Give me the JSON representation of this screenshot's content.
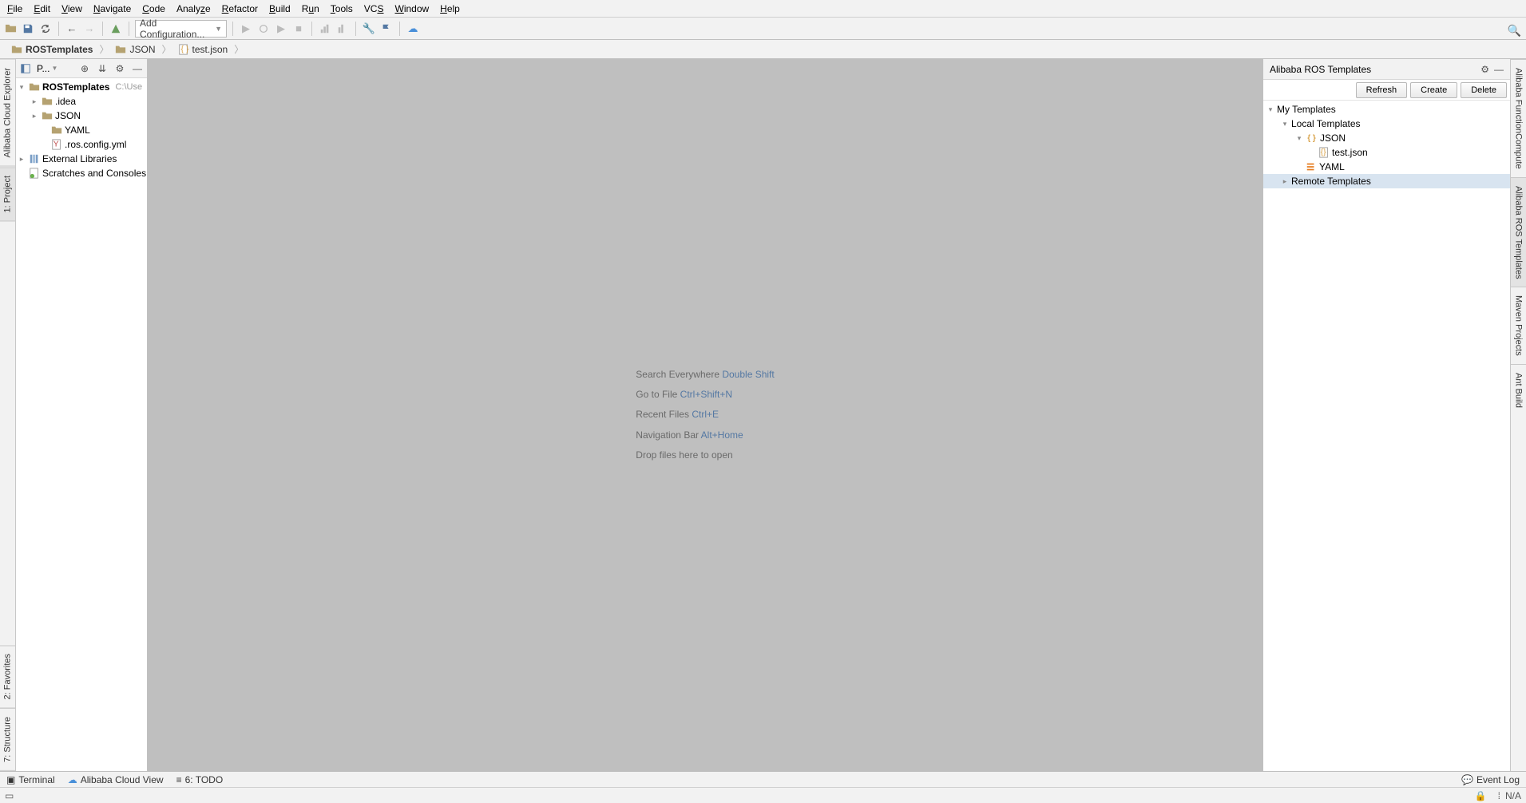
{
  "menu": {
    "items": [
      "File",
      "Edit",
      "View",
      "Navigate",
      "Code",
      "Analyze",
      "Refactor",
      "Build",
      "Run",
      "Tools",
      "VCS",
      "Window",
      "Help"
    ]
  },
  "toolbar": {
    "config": "Add Configuration..."
  },
  "breadcrumb": [
    {
      "icon": "folder",
      "text": "ROSTemplates",
      "bold": true
    },
    {
      "icon": "folder",
      "text": "JSON",
      "bold": false
    },
    {
      "icon": "json",
      "text": "test.json",
      "bold": false
    }
  ],
  "left_tabs": {
    "project": "1: Project",
    "explorer": "Alibaba Cloud Explorer",
    "structure": "7: Structure",
    "favorites": "2: Favorites"
  },
  "right_tabs": {
    "func": "Alibaba FunctionCompute",
    "ros": "Alibaba ROS Templates",
    "maven": "Maven Projects",
    "ant": "Ant Build"
  },
  "project": {
    "header_view": "P...",
    "root": {
      "name": "ROSTemplates",
      "path": "C:\\Use"
    },
    "children": [
      {
        "name": ".idea",
        "kind": "folder",
        "expand": true
      },
      {
        "name": "JSON",
        "kind": "folder",
        "expand": true
      },
      {
        "name": "YAML",
        "kind": "folder",
        "expand": false
      },
      {
        "name": ".ros.config.yml",
        "kind": "yamlfile",
        "expand": false
      }
    ],
    "external": "External Libraries",
    "scratches": "Scratches and Consoles"
  },
  "editor_hints": [
    {
      "label": "Search Everywhere",
      "shortcut": "Double Shift"
    },
    {
      "label": "Go to File",
      "shortcut": "Ctrl+Shift+N"
    },
    {
      "label": "Recent Files",
      "shortcut": "Ctrl+E"
    },
    {
      "label": "Navigation Bar",
      "shortcut": "Alt+Home"
    },
    {
      "label": "Drop files here to open",
      "shortcut": ""
    }
  ],
  "ros": {
    "title": "Alibaba ROS Templates",
    "buttons": {
      "refresh": "Refresh",
      "create": "Create",
      "delete": "Delete"
    },
    "tree": {
      "root": "My Templates",
      "local": "Local Templates",
      "json": "JSON",
      "testjson": "test.json",
      "yaml": "YAML",
      "remote": "Remote Templates"
    }
  },
  "bottom": {
    "terminal": "Terminal",
    "cloudview": "Alibaba Cloud View",
    "todo": "6: TODO",
    "eventlog": "Event Log"
  },
  "status": {
    "encoding": "N/A"
  }
}
